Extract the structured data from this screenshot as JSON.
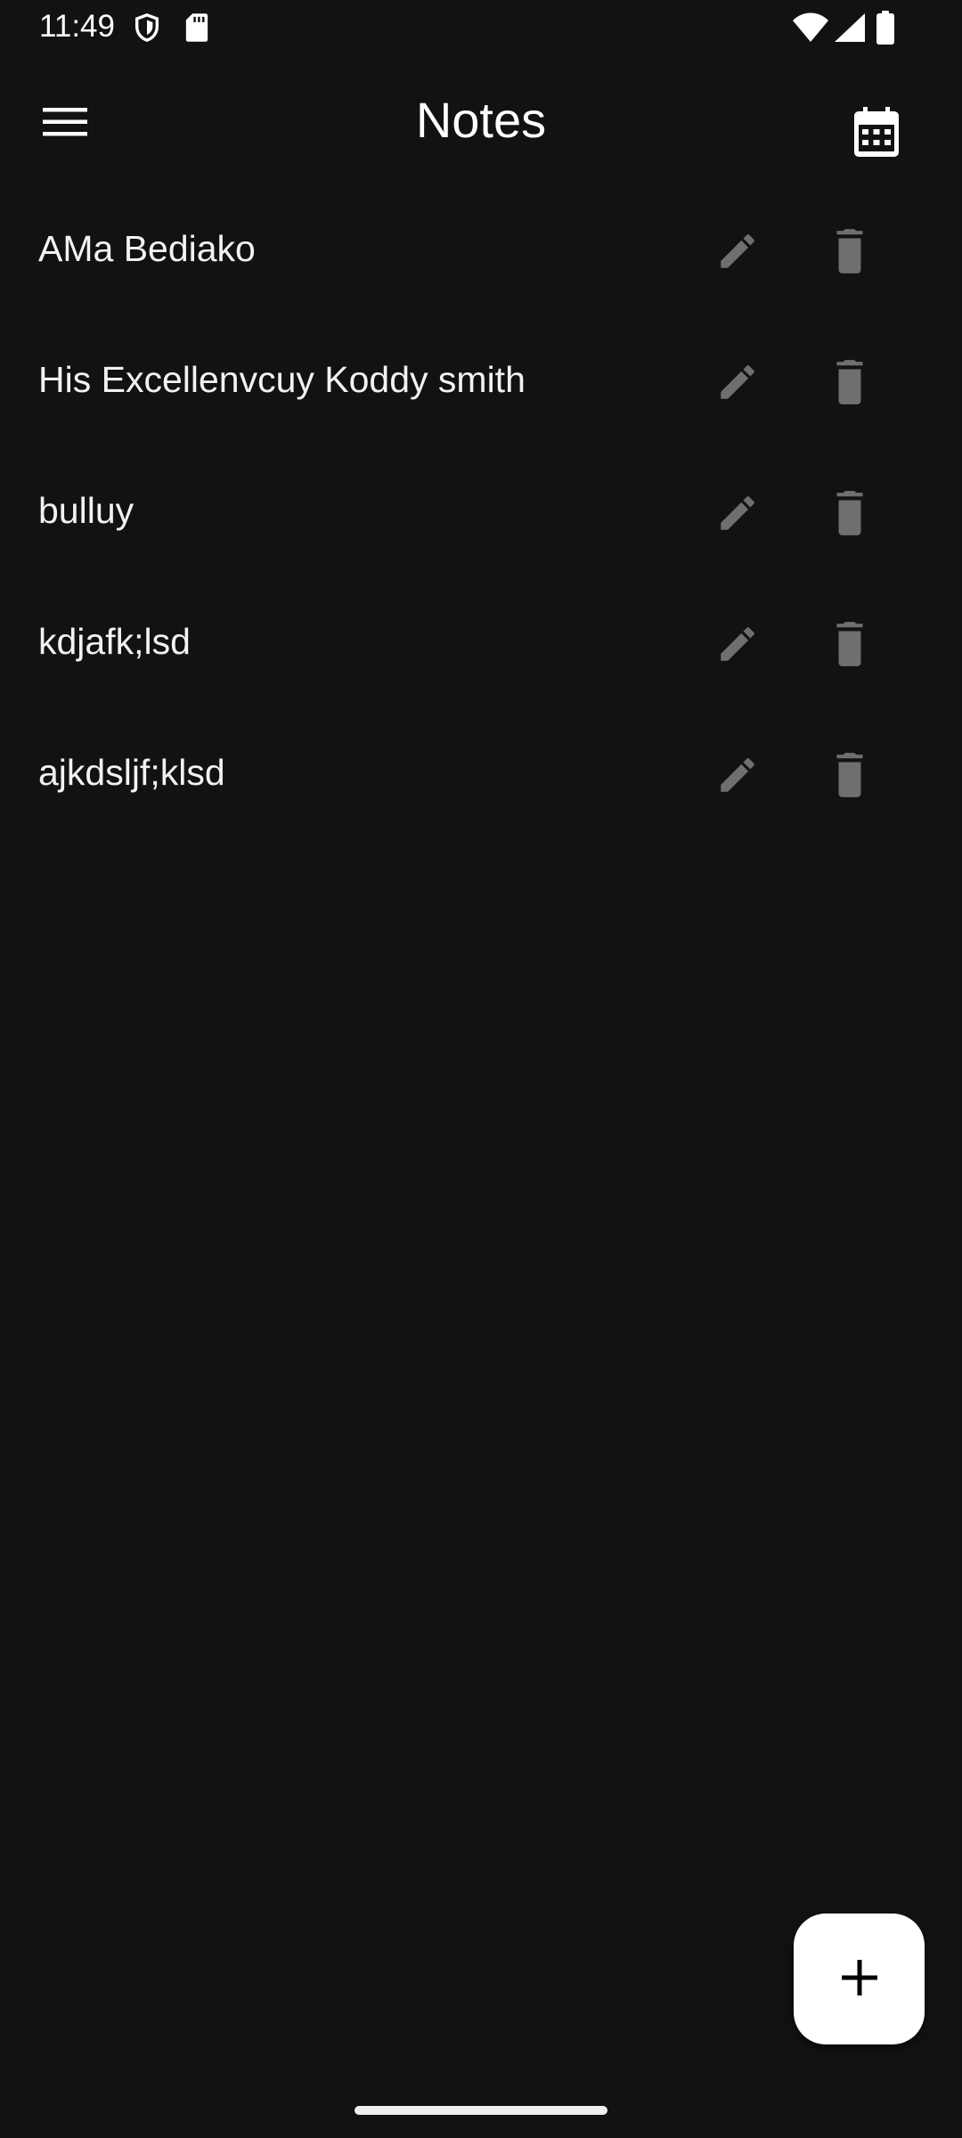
{
  "status_bar": {
    "time": "11:49",
    "icons": [
      "shield-icon",
      "sd-card-icon",
      "wifi-icon",
      "signal-icon",
      "battery-icon"
    ]
  },
  "app_bar": {
    "title": "Notes",
    "left_icon": "menu-icon",
    "right_icon": "calendar-icon"
  },
  "notes": [
    {
      "title": "AMa Bediako",
      "actions": [
        "edit-icon",
        "delete-icon"
      ]
    },
    {
      "title": "His Excellenvcuy Koddy smith",
      "actions": [
        "edit-icon",
        "delete-icon"
      ]
    },
    {
      "title": "bulluy",
      "actions": [
        "edit-icon",
        "delete-icon"
      ]
    },
    {
      "title": "kdjafk;lsd",
      "actions": [
        "edit-icon",
        "delete-icon"
      ]
    },
    {
      "title": "ajkdsljf;klsd",
      "actions": [
        "edit-icon",
        "delete-icon"
      ]
    }
  ],
  "fab": {
    "icon": "plus-icon"
  },
  "colors": {
    "background": "#121212",
    "text": "#ffffff",
    "action_icon": "#6f6f6f",
    "fab_background": "#ffffff",
    "fab_icon": "#000000"
  }
}
